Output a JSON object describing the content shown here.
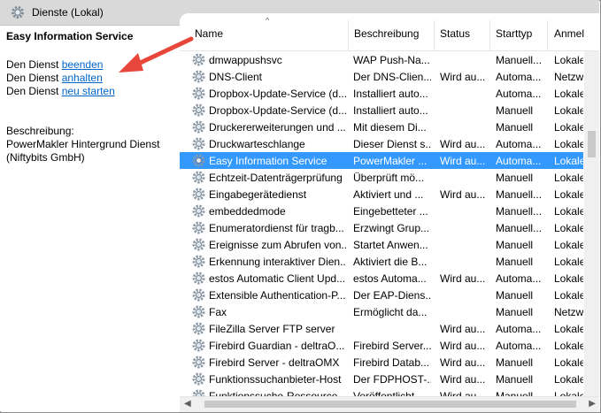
{
  "window": {
    "title": "Dienste (Lokal)"
  },
  "left_pane": {
    "service_title": "Easy Information Service",
    "actions": [
      {
        "prefix": "Den Dienst ",
        "link": "beenden"
      },
      {
        "prefix": "Den Dienst ",
        "link": "anhalten"
      },
      {
        "prefix": "Den Dienst ",
        "link": "neu starten"
      }
    ],
    "description_label": "Beschreibung:",
    "description_text": "PowerMakler Hintergrund Dienst (Niftybits GmbH)"
  },
  "columns": [
    "Name",
    "Beschreibung",
    "Status",
    "Starttyp",
    "Anmel"
  ],
  "rows": [
    {
      "name": "dmwappushsvc",
      "desc": "WAP Push-Na...",
      "status": "",
      "start": "Manuell...",
      "anmel": "Lokale"
    },
    {
      "name": "DNS-Client",
      "desc": "Der DNS-Clien...",
      "status": "Wird au...",
      "start": "Automa...",
      "anmel": "Netzw"
    },
    {
      "name": "Dropbox-Update-Service (d...",
      "desc": "Installiert auto...",
      "status": "",
      "start": "Automa...",
      "anmel": "Lokale"
    },
    {
      "name": "Dropbox-Update-Service (d...",
      "desc": "Installiert auto...",
      "status": "",
      "start": "Manuell",
      "anmel": "Lokale"
    },
    {
      "name": "Druckererweiterungen und ...",
      "desc": "Mit diesem Di...",
      "status": "",
      "start": "Manuell",
      "anmel": "Lokale"
    },
    {
      "name": "Druckwarteschlange",
      "desc": "Dieser Dienst s...",
      "status": "Wird au...",
      "start": "Automa...",
      "anmel": "Lokale"
    },
    {
      "name": "Easy Information Service",
      "desc": "PowerMakler ...",
      "status": "Wird au...",
      "start": "Automa...",
      "anmel": "Lokale",
      "selected": true
    },
    {
      "name": "Echtzeit-Datenträgerprüfung",
      "desc": "Überprüft mö...",
      "status": "",
      "start": "Manuell",
      "anmel": "Lokale"
    },
    {
      "name": "Eingabegerätedienst",
      "desc": "Aktiviert und ...",
      "status": "Wird au...",
      "start": "Manuell...",
      "anmel": "Lokale"
    },
    {
      "name": "embeddedmode",
      "desc": "Eingebetteter ...",
      "status": "",
      "start": "Manuell...",
      "anmel": "Lokale"
    },
    {
      "name": "Enumeratordienst für tragb...",
      "desc": "Erzwingt Grup...",
      "status": "",
      "start": "Manuell...",
      "anmel": "Lokale"
    },
    {
      "name": "Ereignisse zum Abrufen von...",
      "desc": "Startet Anwen...",
      "status": "",
      "start": "Manuell",
      "anmel": "Lokale"
    },
    {
      "name": "Erkennung interaktiver Dien...",
      "desc": "Aktiviert die B...",
      "status": "",
      "start": "Manuell",
      "anmel": "Lokale"
    },
    {
      "name": "estos Automatic Client Upd...",
      "desc": "estos Automa...",
      "status": "Wird au...",
      "start": "Automa...",
      "anmel": "Lokale"
    },
    {
      "name": "Extensible Authentication-P...",
      "desc": "Der EAP-Diens...",
      "status": "",
      "start": "Manuell",
      "anmel": "Lokale"
    },
    {
      "name": "Fax",
      "desc": "Ermöglicht da...",
      "status": "",
      "start": "Manuell",
      "anmel": "Netzw"
    },
    {
      "name": "FileZilla Server FTP server",
      "desc": "",
      "status": "Wird au...",
      "start": "Automa...",
      "anmel": "Lokale"
    },
    {
      "name": "Firebird Guardian - deltraO...",
      "desc": "Firebird Server...",
      "status": "Wird au...",
      "start": "Automa...",
      "anmel": "Lokale"
    },
    {
      "name": "Firebird Server - deltraOMX",
      "desc": "Firebird Datab...",
      "status": "Wird au...",
      "start": "Manuell",
      "anmel": "Lokale"
    },
    {
      "name": "Funktionssuchanbieter-Host",
      "desc": "Der FDPHOST-...",
      "status": "Wird au...",
      "start": "Manuell",
      "anmel": "Lokale"
    },
    {
      "name": "Funktionssuche-Ressource...",
      "desc": "Veröffentlicht ...",
      "status": "Wird au...",
      "start": "Manuell...",
      "anmel": "Lokale"
    }
  ],
  "colors": {
    "selection": "#3399ff",
    "link": "#0066cc",
    "arrow": "#e8463a"
  }
}
